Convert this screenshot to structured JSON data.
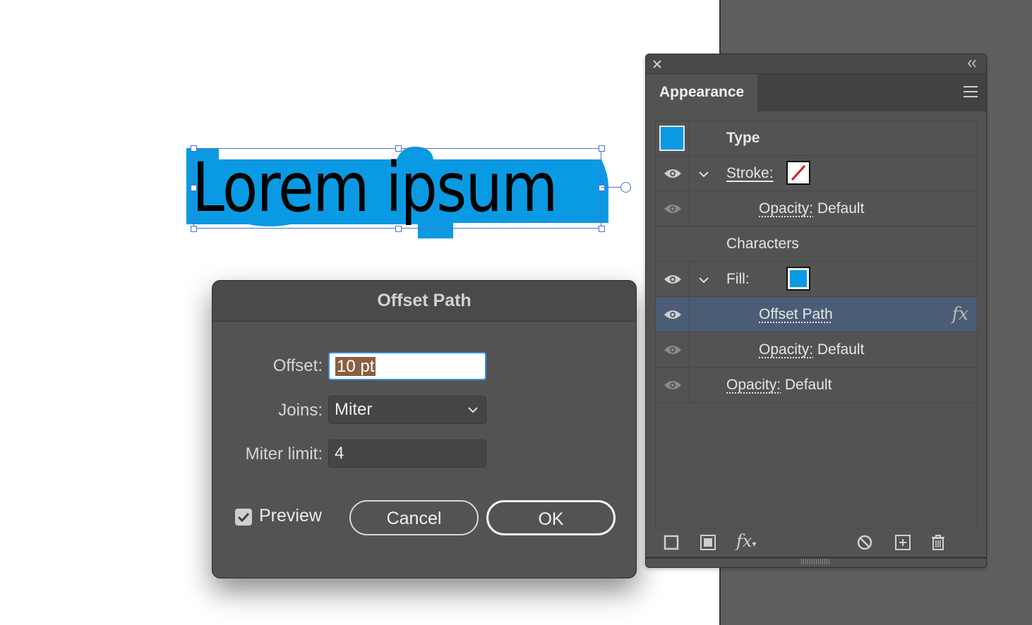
{
  "canvas": {
    "art_text": "Lorem ipsum",
    "offset_color": "#0a9ae3"
  },
  "dialog": {
    "title": "Offset Path",
    "offset_label": "Offset:",
    "offset_value": "10 pt",
    "joins_label": "Joins:",
    "joins_value": "Miter",
    "miter_label": "Miter limit:",
    "miter_value": "4",
    "preview_label": "Preview",
    "preview_checked": true,
    "cancel_label": "Cancel",
    "ok_label": "OK"
  },
  "panel": {
    "tab_label": "Appearance",
    "rows": {
      "type": "Type",
      "stroke": "Stroke:",
      "stroke_opacity_label": "Opacity:",
      "stroke_opacity_value": "Default",
      "characters": "Characters",
      "fill": "Fill:",
      "offset_path": "Offset Path",
      "fill_opacity_label": "Opacity:",
      "fill_opacity_value": "Default",
      "opacity_label": "Opacity:",
      "opacity_value": "Default"
    },
    "colors": {
      "fill": "#0a9ae3",
      "selected_row": "#4b5d75"
    }
  }
}
